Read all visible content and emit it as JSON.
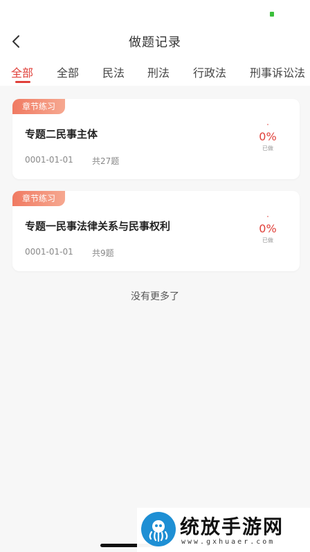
{
  "header": {
    "title": "做题记录"
  },
  "tabs": [
    {
      "label": "全部"
    },
    {
      "label": "全部"
    },
    {
      "label": "民法"
    },
    {
      "label": "刑法"
    },
    {
      "label": "行政法"
    },
    {
      "label": "刑事诉讼法"
    }
  ],
  "records": [
    {
      "tag": "章节练习",
      "title": "专题二民事主体",
      "date": "0001-01-01",
      "count": "共27题",
      "progress": "0%",
      "progress_label": "已做"
    },
    {
      "tag": "章节练习",
      "title": "专题一民事法律关系与民事权利",
      "date": "0001-01-01",
      "count": "共9题",
      "progress": "0%",
      "progress_label": "已做"
    }
  ],
  "footer_text": "没有更多了",
  "watermark": {
    "title": "统放手游网",
    "url": "www.gxhuaer.com"
  },
  "colors": {
    "accent": "#e0403a",
    "tag_gradient_start": "#f07a62",
    "tag_gradient_end": "#f6a890",
    "background": "#f7f7f7"
  }
}
